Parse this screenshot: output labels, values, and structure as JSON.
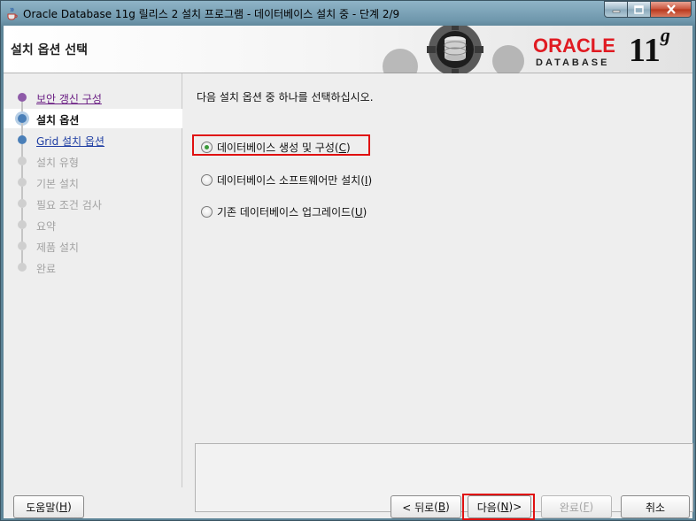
{
  "window": {
    "title": "Oracle Database 11g 릴리스 2 설치 프로그램 - 데이터베이스 설치 중 - 단계 2/9",
    "icons": [
      "java-cup-icon",
      "minimize-icon",
      "maximize-icon",
      "close-icon"
    ]
  },
  "banner": {
    "title": "설치 옵션 선택",
    "logo_oracle": "ORACLE",
    "logo_database": "DATABASE",
    "logo_version": "11",
    "logo_version_suffix": "g"
  },
  "steps": [
    {
      "label": "보안 갱신 구성",
      "state": "visited"
    },
    {
      "label": "설치 옵션",
      "state": "current"
    },
    {
      "label": "Grid 설치 옵션",
      "state": "link"
    },
    {
      "label": "설치 유형",
      "state": "disabled"
    },
    {
      "label": "기본 설치",
      "state": "disabled"
    },
    {
      "label": "필요 조건 검사",
      "state": "disabled"
    },
    {
      "label": "요약",
      "state": "disabled"
    },
    {
      "label": "제품 설치",
      "state": "disabled"
    },
    {
      "label": "완료",
      "state": "disabled"
    }
  ],
  "main": {
    "prompt": "다음 설치 옵션 중 하나를 선택하십시오.",
    "options": [
      {
        "label": "데이터베이스 생성 및 구성",
        "mnemonic": "C",
        "checked": true
      },
      {
        "label": "데이터베이스 소프트웨어만 설치",
        "mnemonic": "I",
        "checked": false
      },
      {
        "label": "기존 데이터베이스 업그레이드",
        "mnemonic": "U",
        "checked": false
      }
    ]
  },
  "footer": {
    "help": {
      "label": "도움말",
      "mnemonic": "H"
    },
    "back": {
      "label": "< 뒤로",
      "mnemonic": "B"
    },
    "next": {
      "label": "다음",
      "mnemonic": "N",
      "suffix": " >"
    },
    "finish": {
      "label": "완료",
      "mnemonic": "F"
    },
    "cancel": {
      "label": "취소"
    }
  },
  "colors": {
    "highlight": "#e01010",
    "oracle_red": "#e01b22",
    "visited_link": "#6b1f84",
    "link": "#1f3ea3"
  }
}
